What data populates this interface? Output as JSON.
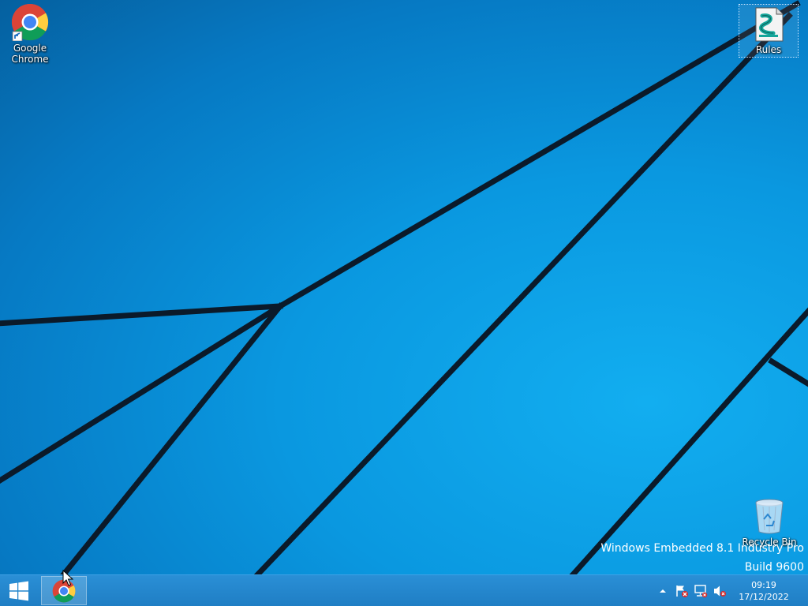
{
  "desktop": {
    "icons": [
      {
        "label_line1": "Google",
        "label_line2": "Chrome",
        "icon": "chrome-icon"
      },
      {
        "label": "Rules",
        "icon": "script-file-icon"
      },
      {
        "label": "Recycle Bin",
        "icon": "recycle-bin-icon"
      }
    ],
    "watermark": {
      "line1": "Windows Embedded 8.1 Industry Pro",
      "line2": "Build 9600"
    }
  },
  "taskbar": {
    "start": {
      "icon": "windows-logo-icon"
    },
    "pinned": [
      {
        "icon": "chrome-icon",
        "app": "Google Chrome"
      }
    ],
    "tray": {
      "icons": [
        "show-hidden-icons-icon",
        "action-center-flag-icon",
        "network-icon",
        "volume-muted-icon"
      ],
      "clock": {
        "time": "09:19",
        "date": "17/12/2022"
      }
    }
  },
  "colors": {
    "wallpaper_blue": "#0a98e0",
    "taskbar_blue": "#2a8fd6"
  }
}
